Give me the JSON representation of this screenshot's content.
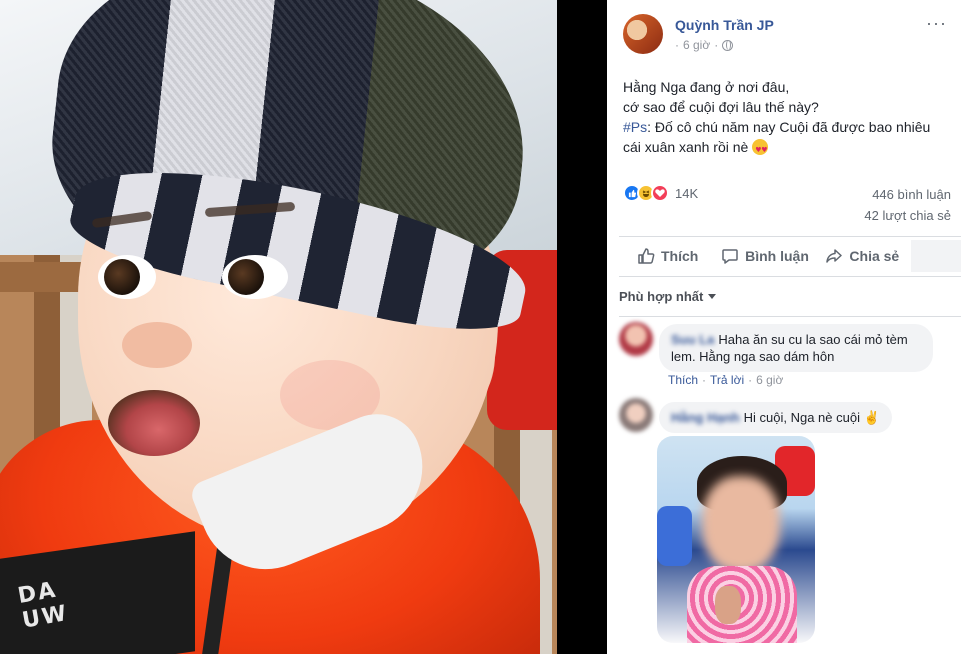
{
  "post": {
    "author": "Quỳnh Trần JP",
    "time": "6 giờ",
    "menu_label": "···",
    "text_line1": "Hằng Nga đang ở nơi đâu,",
    "text_line2": "cớ sao để cuội đợi lâu thế này?",
    "text_tag": "#Ps",
    "text_line3": ": Đố cô chú năm nay Cuội đã được bao nhiêu",
    "text_line4": "cái xuân xanh rồi nè",
    "reaction_count": "14K",
    "comment_count": "446 bình luận",
    "share_count": "42 lượt chia sẻ"
  },
  "actions": {
    "like": "Thích",
    "comment": "Bình luận",
    "share": "Chia sẻ"
  },
  "sort_label": "Phù hợp nhất",
  "comments": [
    {
      "name": "Suu La",
      "text": "Haha ăn su cu la sao cái mỏ tèm",
      "text2": "lem. Hằng nga sao dám hôn",
      "like": "Thích",
      "dot": "·",
      "reply": "Trả lời",
      "time": "6 giờ"
    },
    {
      "name": "Hằng Hạnh",
      "text": "Hi cuội, Nga nè cuội ✌"
    }
  ],
  "photo_patch_text": "DA\nUW",
  "colors": {
    "link": "#385898",
    "like_blue": "#1877f2",
    "love_red": "#f33e58",
    "haha_yellow": "#f7c233",
    "jacket_orange": "#f03b10"
  },
  "icons": [
    "globe-icon",
    "like-icon",
    "haha-icon",
    "love-icon",
    "thumbs-up-icon",
    "comment-icon",
    "share-icon",
    "caret-down-icon",
    "heart-eyes-emoji-icon"
  ]
}
